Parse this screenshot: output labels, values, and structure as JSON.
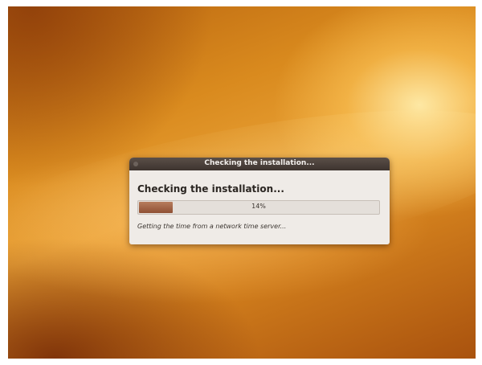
{
  "dialog": {
    "title": "Checking the installation...",
    "heading": "Checking the installation...",
    "progress_percent": 14,
    "progress_label": "14%",
    "status_text": "Getting the time from a network time server..."
  },
  "colors": {
    "titlebar": "#3d342f",
    "dialog_bg": "#efebe7",
    "progress_fill": "#8f4f33",
    "desktop_accent": "#d98a1e"
  }
}
